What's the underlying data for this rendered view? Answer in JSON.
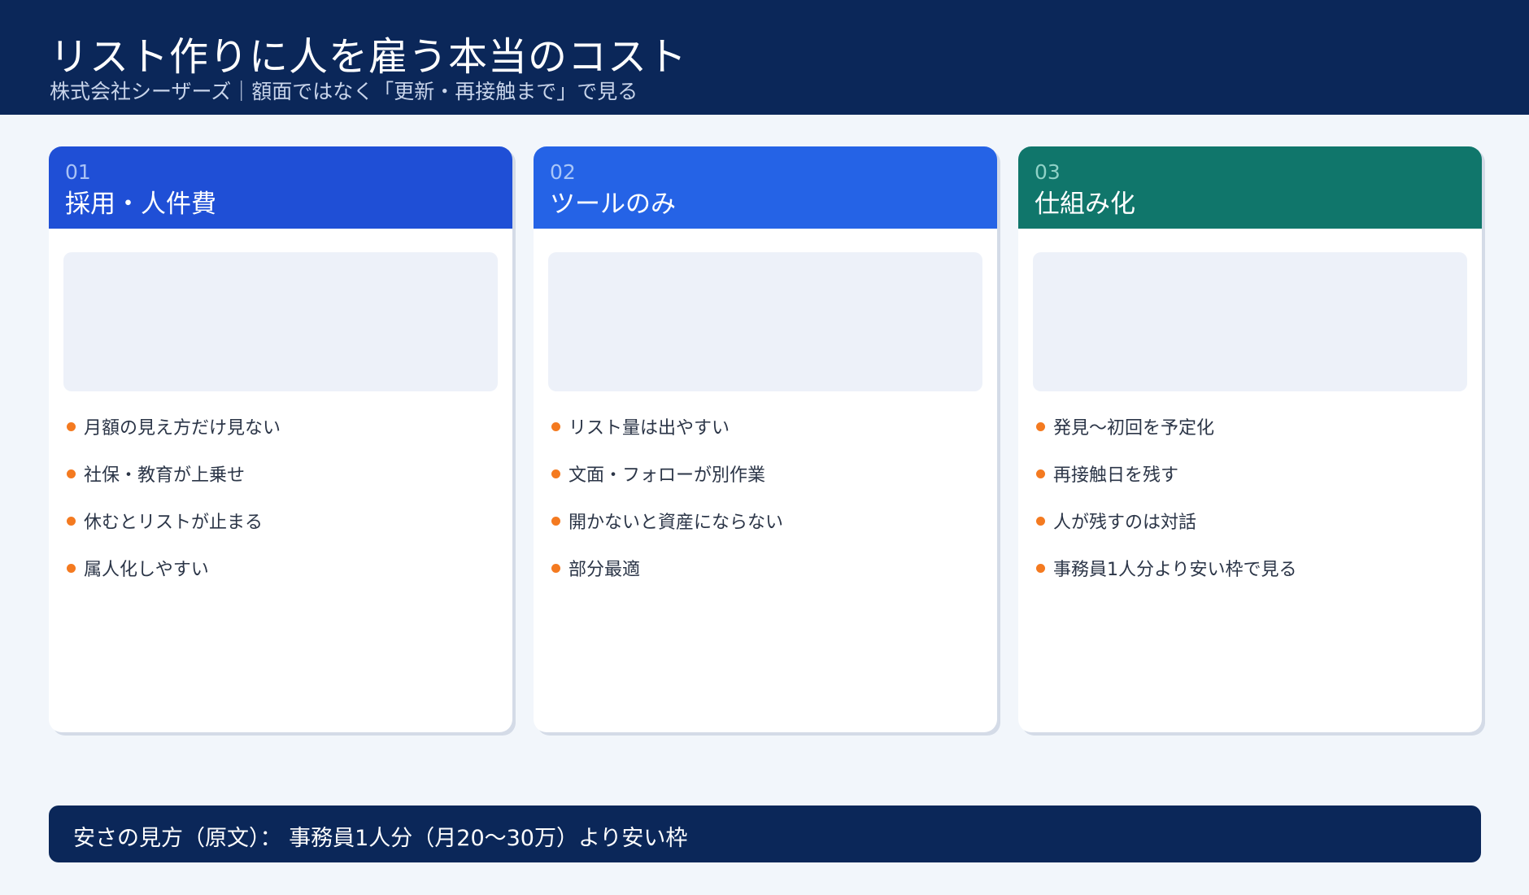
{
  "header": {
    "title": "リスト作りに人を雇う本当のコスト",
    "subtitle": "株式会社シーザーズ｜額面ではなく「更新・再接触まで」で見る"
  },
  "cards": [
    {
      "number": "01",
      "title": "採用・人件費",
      "header_color": "#1f4fd6",
      "number_color": "#a9c2f5",
      "bullets": [
        "月額の見え方だけ見ない",
        "社保・教育が上乗せ",
        "休むとリストが止まる",
        "属人化しやすい"
      ]
    },
    {
      "number": "02",
      "title": "ツールのみ",
      "header_color": "#2563e6",
      "number_color": "#a9c6f8",
      "bullets": [
        "リスト量は出やすい",
        "文面・フォローが別作業",
        "開かないと資産にならない",
        "部分最適"
      ]
    },
    {
      "number": "03",
      "title": "仕組み化",
      "header_color": "#10766b",
      "number_color": "#8fd1c6",
      "bullets": [
        "発見〜初回を予定化",
        "再接触日を残す",
        "人が残すのは対話",
        "事務員1人分より安い枠で見る"
      ]
    }
  ],
  "footer": {
    "text": "安さの見方（原文）： 事務員1人分（月20〜30万）より安い枠"
  },
  "colors": {
    "header_bg": "#0b2759",
    "page_bg": "#f2f6fb",
    "bullet_dot": "#f47a20"
  }
}
